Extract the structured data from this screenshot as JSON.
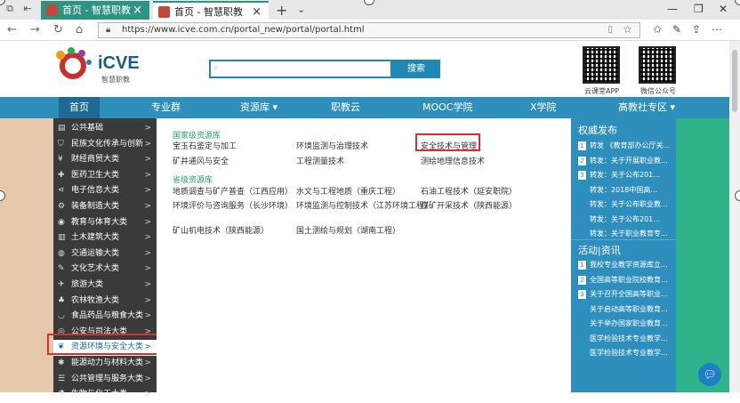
{
  "browser": {
    "tabs": [
      {
        "title": "首页 - 智慧职教",
        "active": false
      },
      {
        "title": "首页 - 智慧职教",
        "active": true
      }
    ],
    "new_tab": "+",
    "url": "https://www.icve.com.cn/portal_new/portal/portal.html"
  },
  "site": {
    "logo_text": "iCVE",
    "logo_sub": "智慧职教",
    "search_button": "搜索",
    "qr_codes": [
      {
        "label": "云课堂APP"
      },
      {
        "label": "微信公众号"
      }
    ]
  },
  "nav": {
    "items": [
      {
        "label": "首页",
        "active": true
      },
      {
        "label": "专业群"
      },
      {
        "label": "资源库 ▾"
      },
      {
        "label": "职教云"
      },
      {
        "label": "MOOC学院"
      },
      {
        "label": "X学院"
      },
      {
        "label": "高教社专区 ▾"
      }
    ]
  },
  "categories": [
    {
      "label": "公共基础",
      "icon": "book-icon"
    },
    {
      "label": "民族文化传承与创新",
      "icon": "shield-icon"
    },
    {
      "label": "财经商贸大类",
      "icon": "money-icon"
    },
    {
      "label": "医药卫生大类",
      "icon": "medical-icon"
    },
    {
      "label": "电子信息大类",
      "icon": "share-icon"
    },
    {
      "label": "装备制造大类",
      "icon": "gear-icon"
    },
    {
      "label": "教育与体育大类",
      "icon": "ball-icon"
    },
    {
      "label": "土木建筑大类",
      "icon": "building-icon"
    },
    {
      "label": "交通运输大类",
      "icon": "globe-icon"
    },
    {
      "label": "文化艺术大类",
      "icon": "pen-icon"
    },
    {
      "label": "旅游大类",
      "icon": "plane-icon"
    },
    {
      "label": "农林牧渔大类",
      "icon": "tree-icon"
    },
    {
      "label": "食品药品与粮食大类",
      "icon": "bowl-icon"
    },
    {
      "label": "公安与司法大类",
      "icon": "badge-icon"
    },
    {
      "label": "资源环境与安全大类",
      "icon": "leaf-icon",
      "selected": true
    },
    {
      "label": "能源动力与材料大类",
      "icon": "energy-icon"
    },
    {
      "label": "公共管理与服务大类",
      "icon": "list-icon"
    },
    {
      "label": "生物与化工大类",
      "icon": "flask-icon"
    }
  ],
  "panel": {
    "national_title": "国家级资源库",
    "national_courses": [
      "宝玉石鉴定与加工",
      "环境监测与治理技术",
      "安全技术与管理",
      "矿井通风与安全",
      "工程测量技术",
      "测绘地理信息技术"
    ],
    "provincial_title": "省级资源库",
    "provincial_courses": [
      "地质调查与矿产普查（江西应用）",
      "水文与工程地质（重庆工程）",
      "石油工程技术（延安职院）",
      "环境评价与咨询服务（长沙环境）",
      "环境监测与控制技术（江苏环境工程）",
      "煤矿开采技术（陕西能源）",
      "矿山机电技术（陕西能源）",
      "国土测绘与规划（湖南工程）"
    ]
  },
  "info": {
    "auth_title": "权威发布",
    "auth_items": [
      {
        "num": "1",
        "text": "转发 《教育部办公厅关..."
      },
      {
        "num": "2",
        "text": "转发：关于开展职业教..."
      },
      {
        "num": "3",
        "text": "转发：关于公布201..."
      },
      {
        "num": "",
        "text": "转发：2018中国高..."
      },
      {
        "num": "",
        "text": "转发：关于公布职业教..."
      },
      {
        "num": "",
        "text": "转发：关于公布201..."
      },
      {
        "num": "",
        "text": "转发：关于职业教育专..."
      }
    ],
    "news_title": "活动|资讯",
    "news_items": [
      {
        "num": "1",
        "text": "我校专业教学资源库立..."
      },
      {
        "num": "2",
        "text": "全国高等职业院校教育..."
      },
      {
        "num": "3",
        "text": "关于召开全国高等职业..."
      },
      {
        "num": "",
        "text": "关于启动高等职业教育..."
      },
      {
        "num": "",
        "text": "关于举办国家职业教育..."
      },
      {
        "num": "",
        "text": "医学检验技术专业教学..."
      },
      {
        "num": "",
        "text": "医学检验技术专业教学..."
      }
    ]
  }
}
